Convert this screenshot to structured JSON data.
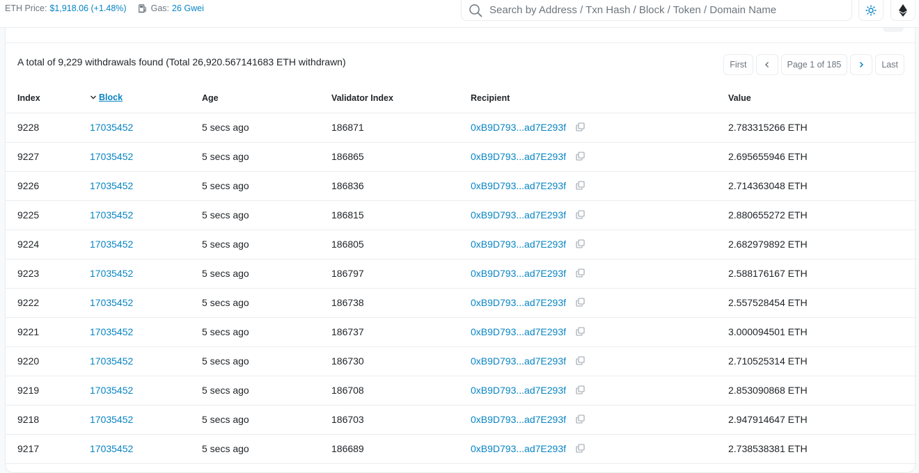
{
  "topbar": {
    "eth_price_label": "ETH Price:",
    "eth_price_value": "$1,918.06 (+1.48%)",
    "gas_label": "Gas:",
    "gas_value": "26 Gwei"
  },
  "search": {
    "placeholder": "Search by Address / Txn Hash / Block / Token / Domain Name",
    "icon": "search-icon"
  },
  "header_buttons": {
    "theme_icon": "sun-icon",
    "network_icon": "ethereum-icon"
  },
  "summary": {
    "text": "A total of 9,229 withdrawals found (Total 26,920.567141683 ETH withdrawn)"
  },
  "pagination": {
    "first": "First",
    "page_info": "Page 1 of 185",
    "last": "Last"
  },
  "table": {
    "columns": {
      "index": "Index",
      "block": "Block",
      "age": "Age",
      "validator": "Validator Index",
      "recipient": "Recipient",
      "value": "Value"
    },
    "rows": [
      {
        "index": "9228",
        "block": "17035452",
        "age": "5 secs ago",
        "validator": "186871",
        "recipient": "0xB9D793...ad7E293f",
        "value": "2.783315266 ETH"
      },
      {
        "index": "9227",
        "block": "17035452",
        "age": "5 secs ago",
        "validator": "186865",
        "recipient": "0xB9D793...ad7E293f",
        "value": "2.695655946 ETH"
      },
      {
        "index": "9226",
        "block": "17035452",
        "age": "5 secs ago",
        "validator": "186836",
        "recipient": "0xB9D793...ad7E293f",
        "value": "2.714363048 ETH"
      },
      {
        "index": "9225",
        "block": "17035452",
        "age": "5 secs ago",
        "validator": "186815",
        "recipient": "0xB9D793...ad7E293f",
        "value": "2.880655272 ETH"
      },
      {
        "index": "9224",
        "block": "17035452",
        "age": "5 secs ago",
        "validator": "186805",
        "recipient": "0xB9D793...ad7E293f",
        "value": "2.682979892 ETH"
      },
      {
        "index": "9223",
        "block": "17035452",
        "age": "5 secs ago",
        "validator": "186797",
        "recipient": "0xB9D793...ad7E293f",
        "value": "2.588176167 ETH"
      },
      {
        "index": "9222",
        "block": "17035452",
        "age": "5 secs ago",
        "validator": "186738",
        "recipient": "0xB9D793...ad7E293f",
        "value": "2.557528454 ETH"
      },
      {
        "index": "9221",
        "block": "17035452",
        "age": "5 secs ago",
        "validator": "186737",
        "recipient": "0xB9D793...ad7E293f",
        "value": "3.000094501 ETH"
      },
      {
        "index": "9220",
        "block": "17035452",
        "age": "5 secs ago",
        "validator": "186730",
        "recipient": "0xB9D793...ad7E293f",
        "value": "2.710525314 ETH"
      },
      {
        "index": "9219",
        "block": "17035452",
        "age": "5 secs ago",
        "validator": "186708",
        "recipient": "0xB9D793...ad7E293f",
        "value": "2.853090868 ETH"
      },
      {
        "index": "9218",
        "block": "17035452",
        "age": "5 secs ago",
        "validator": "186703",
        "recipient": "0xB9D793...ad7E293f",
        "value": "2.947914647 ETH"
      },
      {
        "index": "9217",
        "block": "17035452",
        "age": "5 secs ago",
        "validator": "186689",
        "recipient": "0xB9D793...ad7E293f",
        "value": "2.738538381 ETH"
      }
    ]
  },
  "colors": {
    "link": "#0784c3",
    "muted": "#6c757d",
    "border": "#e9ecef"
  }
}
